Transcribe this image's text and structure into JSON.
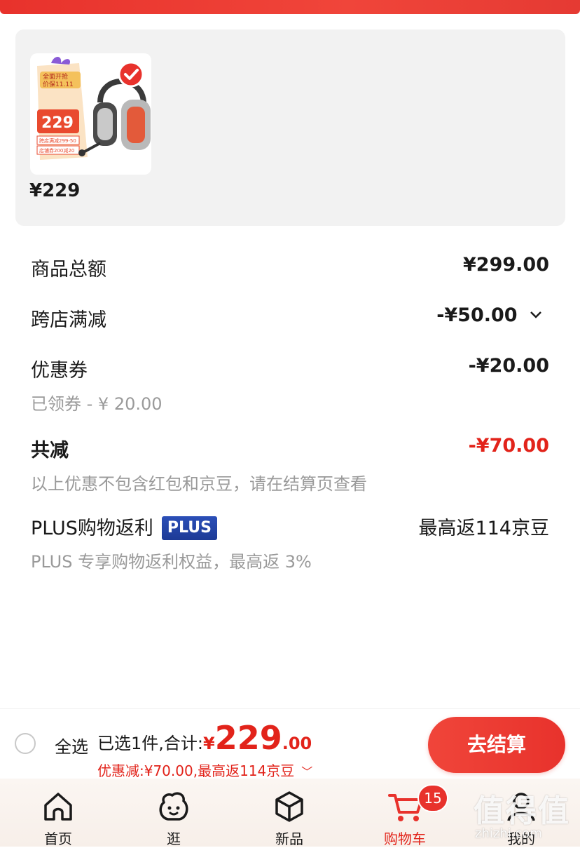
{
  "product": {
    "price": "¥229",
    "promo_image": {
      "line1": "全面开抢",
      "line2": "价保11.11",
      "price": "229",
      "small_lines": [
        "跨店满减299-50",
        "店铺券200减20"
      ]
    }
  },
  "summary_rows": {
    "goods_total": {
      "label": "商品总额",
      "value": "¥299.00"
    },
    "cross_store": {
      "label": "跨店满减",
      "value": "-¥50.00"
    },
    "coupon": {
      "label": "优惠券",
      "value": "-¥20.00",
      "sub": "已领券 - ¥ 20.00"
    },
    "total_discount": {
      "label": "共减",
      "value": "-¥70.00",
      "sub": "以上优惠不包含红包和京豆，请在结算页查看"
    },
    "plus_rebate": {
      "label": "PLUS购物返利",
      "badge": "PLUS",
      "value": "最高返114京豆",
      "sub": "PLUS 专享购物返利权益，最高返 3%"
    }
  },
  "checkout": {
    "select_all": "全选",
    "selected_text": "已选1件,合计:",
    "currency": "¥",
    "amount_main": "229",
    "amount_cents": ".00",
    "discount_line": "优惠减:¥70.00,最高返114京豆",
    "button": "去结算"
  },
  "tabs": [
    {
      "label": "首页",
      "icon": "home-icon"
    },
    {
      "label": "逛",
      "icon": "explore-face-icon"
    },
    {
      "label": "新品",
      "icon": "new-cube-icon"
    },
    {
      "label": "购物车",
      "icon": "cart-icon",
      "badge": "15",
      "active": true
    },
    {
      "label": "我的",
      "icon": "profile-icon"
    }
  ],
  "watermark": {
    "text": "值得值",
    "url": "zhizhi.com"
  },
  "colors": {
    "accent": "#e2231a",
    "plus_badge": "#1d3a96",
    "card_bg": "#f2f2f2"
  }
}
